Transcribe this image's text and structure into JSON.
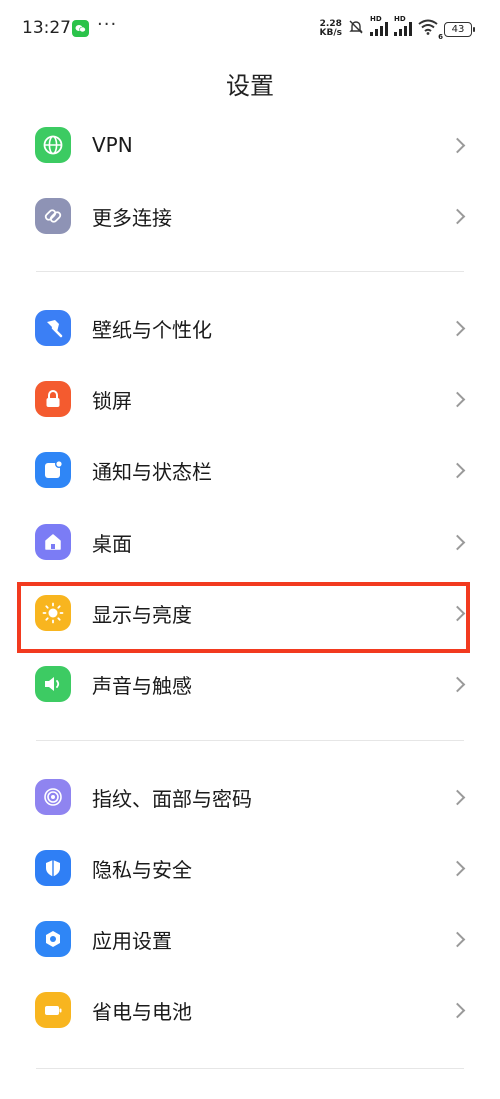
{
  "status_bar": {
    "time": "13:27",
    "speed_value": "2.28",
    "speed_unit": "KB/s",
    "hd_label": "HD",
    "battery": "43",
    "wifi_badge": "6"
  },
  "header": {
    "title": "设置"
  },
  "items": [
    {
      "label": "VPN",
      "icon": "globe-icon",
      "color": "#3ccb62"
    },
    {
      "label": "更多连接",
      "icon": "link-icon",
      "color": "#8e93b5"
    },
    {
      "label": "壁纸与个性化",
      "icon": "brush-icon",
      "color": "#3b7ff5"
    },
    {
      "label": "锁屏",
      "icon": "lock-icon",
      "color": "#f45b2f"
    },
    {
      "label": "通知与状态栏",
      "icon": "notification-icon",
      "color": "#2f86f6"
    },
    {
      "label": "桌面",
      "icon": "home-icon",
      "color": "#7b7cf5"
    },
    {
      "label": "显示与亮度",
      "icon": "sun-icon",
      "color": "#f8b51f"
    },
    {
      "label": "声音与触感",
      "icon": "speaker-icon",
      "color": "#3dcb63"
    },
    {
      "label": "指纹、面部与密码",
      "icon": "fingerprint-icon",
      "color": "#8f84f0"
    },
    {
      "label": "隐私与安全",
      "icon": "shield-icon",
      "color": "#2f7ff5"
    },
    {
      "label": "应用设置",
      "icon": "app-settings-icon",
      "color": "#2f86f6"
    },
    {
      "label": "省电与电池",
      "icon": "battery-icon",
      "color": "#f8b51f"
    }
  ]
}
